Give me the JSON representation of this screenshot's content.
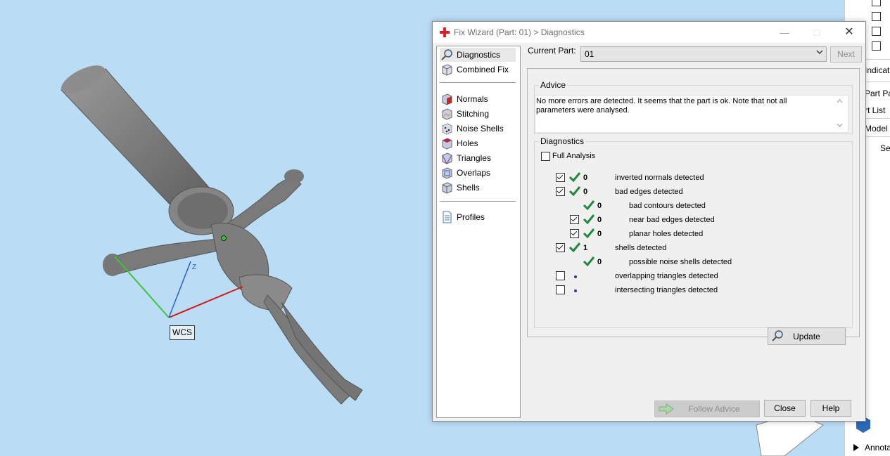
{
  "viewport": {
    "wcs_label": "WCS",
    "axis_z_label": "Z"
  },
  "right_panel": {
    "items": [
      "Indicat",
      "Part Pac",
      "rt List",
      "Model",
      "Sel",
      "Annota"
    ]
  },
  "dialog": {
    "title": "Fix Wizard (Part: 01) > Diagnostics",
    "nav": {
      "items": [
        {
          "label": "Diagnostics",
          "icon": "magnifier-icon",
          "selected": true
        },
        {
          "label": "Combined Fix",
          "icon": "cube-icon"
        },
        {
          "label": "Normals",
          "icon": "normals-cube-icon"
        },
        {
          "label": "Stitching",
          "icon": "stitching-cube-icon"
        },
        {
          "label": "Noise Shells",
          "icon": "noise-shells-icon"
        },
        {
          "label": "Holes",
          "icon": "holes-cube-icon"
        },
        {
          "label": "Triangles",
          "icon": "triangles-cube-icon"
        },
        {
          "label": "Overlaps",
          "icon": "overlaps-cube-icon"
        },
        {
          "label": "Shells",
          "icon": "shells-cube-icon"
        },
        {
          "label": "Profiles",
          "icon": "document-icon"
        }
      ]
    },
    "current_part": {
      "label": "Current Part:",
      "value": "01"
    },
    "next_label": "Next",
    "advice": {
      "title": "Advice",
      "text": "No more errors are detected. It seems that the part is ok. Note that not all parameters were analysed."
    },
    "diagnostics": {
      "title": "Diagnostics",
      "full_analysis_label": "Full Analysis",
      "rows": [
        {
          "checked": true,
          "status": "ok",
          "count": "0",
          "label": "inverted normals detected"
        },
        {
          "checked": true,
          "status": "ok",
          "count": "0",
          "label": "bad edges detected"
        },
        {
          "checked": null,
          "status": "ok",
          "count": "0",
          "label": "bad contours detected"
        },
        {
          "checked": true,
          "status": "ok",
          "count": "0",
          "label": "near bad edges detected"
        },
        {
          "checked": true,
          "status": "ok",
          "count": "0",
          "label": "planar holes detected"
        },
        {
          "checked": true,
          "status": "ok",
          "count": "1",
          "label": "shells detected"
        },
        {
          "checked": null,
          "status": "ok",
          "count": "0",
          "label": "possible noise shells detected"
        },
        {
          "checked": false,
          "status": "pending",
          "count": "",
          "label": "overlapping triangles detected"
        },
        {
          "checked": false,
          "status": "pending",
          "count": "",
          "label": "intersecting triangles detected"
        }
      ],
      "update_label": "Update"
    },
    "buttons": {
      "follow_advice": "Follow Advice",
      "close": "Close",
      "help": "Help"
    }
  },
  "colors": {
    "viewport_bg": "#badcf5",
    "ok_tick": "#1e8a3a",
    "pending_dot": "#1a3fa3",
    "axis_x": "#d11a1a",
    "axis_y": "#3cc43c",
    "axis_z": "#2a5fd1"
  }
}
